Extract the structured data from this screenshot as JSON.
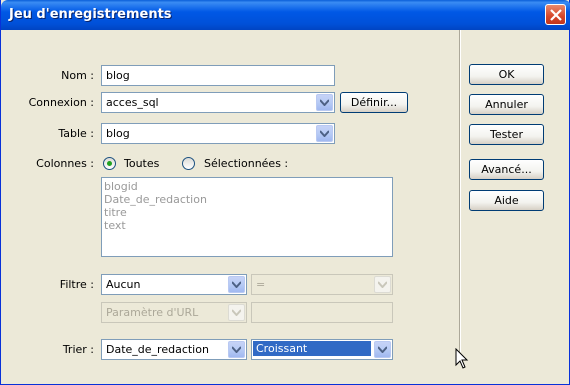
{
  "window": {
    "title": "Jeu d'enregistrements"
  },
  "form": {
    "nom": {
      "label": "Nom :",
      "value": "blog"
    },
    "connexion": {
      "label": "Connexion :",
      "value": "acces_sql",
      "define_button": "Définir..."
    },
    "table": {
      "label": "Table :",
      "value": "blog"
    },
    "colonnes": {
      "label": "Colonnes :",
      "option_all": "Toutes",
      "option_selected": "Sélectionnées :",
      "items": [
        "blogid",
        "Date_de_redaction",
        "titre",
        "text"
      ]
    },
    "filtre": {
      "label": "Filtre :",
      "value": "Aucun",
      "operator": "=",
      "param_type": "Paramètre d'URL",
      "param_value": ""
    },
    "trier": {
      "label": "Trier :",
      "column": "Date_de_redaction",
      "order": "Croissant"
    }
  },
  "buttons": {
    "ok": "OK",
    "annuler": "Annuler",
    "tester": "Tester",
    "avance": "Avancé...",
    "aide": "Aide"
  }
}
